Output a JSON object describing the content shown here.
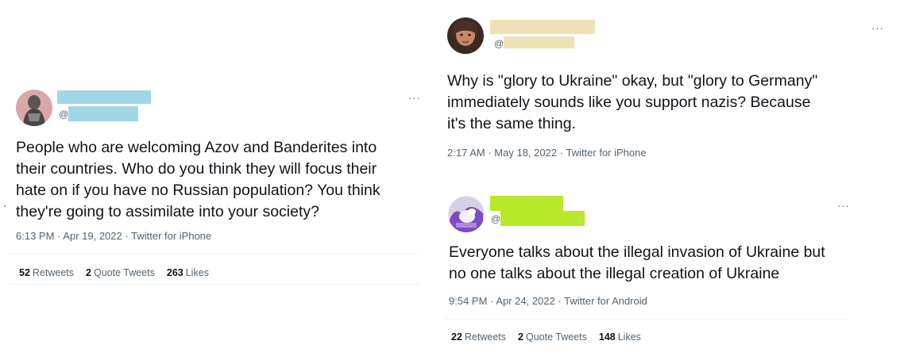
{
  "colors": {
    "redact_blue": "#a0d7e6",
    "redact_yellow": "#ece2b6",
    "redact_green": "#b7e82a"
  },
  "tweets": [
    {
      "at_symbol": "@",
      "more_icon": "more-horizontal-icon",
      "text": "People who are welcoming Azov and Banderites into\ntheir countries. Who do you think they will focus their\nhate on if you have no Russian population? You think\nthey're going to assimilate into your society?",
      "time": "6:13 PM",
      "date": "Apr 19, 2022",
      "source": "Twitter for iPhone",
      "retweets_count": "52",
      "retweets_label": "Retweets",
      "quotes_count": "2",
      "quotes_label": "Quote Tweets",
      "likes_count": "263",
      "likes_label": "Likes"
    },
    {
      "at_symbol": "@",
      "more_icon": "more-horizontal-icon",
      "text": "Why is \"glory to Ukraine\" okay, but \"glory to Germany\"\nimmediately sounds like you support nazis? Because\nit's the same thing.",
      "time": "2:17 AM",
      "date": "May 18, 2022",
      "source": "Twitter for iPhone"
    },
    {
      "at_symbol": "@",
      "more_icon": "more-horizontal-icon",
      "text": "Everyone talks about the illegal invasion of Ukraine but\nno one talks about the illegal creation of Ukraine",
      "time": "9:54 PM",
      "date": "Apr 24, 2022",
      "source": "Twitter for Android",
      "retweets_count": "22",
      "retweets_label": "Retweets",
      "quotes_count": "2",
      "quotes_label": "Quote Tweets",
      "likes_count": "148",
      "likes_label": "Likes"
    }
  ],
  "separator": "·"
}
